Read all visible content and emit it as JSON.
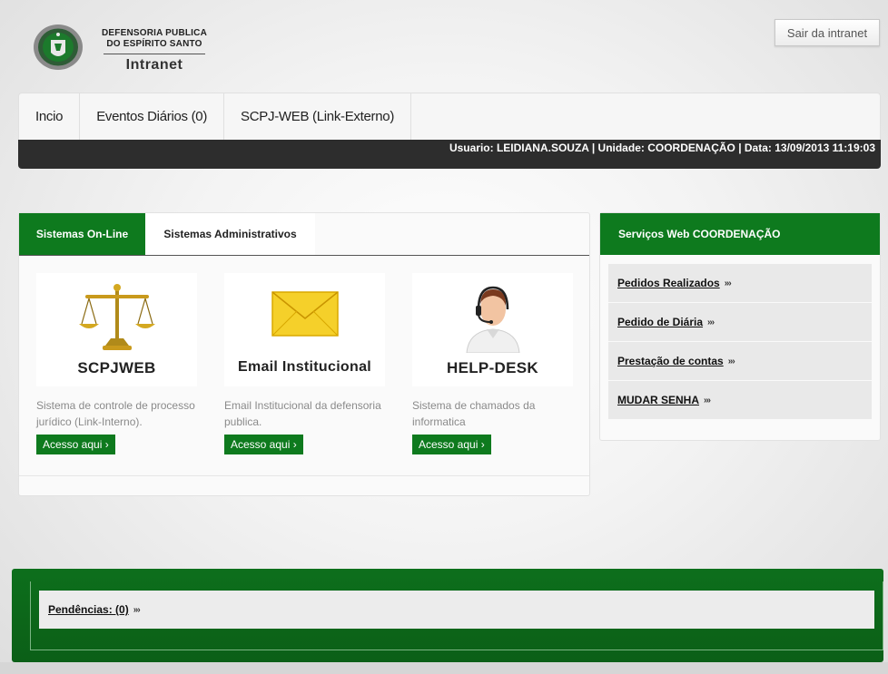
{
  "header": {
    "org_line1": "DEFENSORIA PUBLICA",
    "org_line2": "DO ESPÍRITO SANTO",
    "brand": "Intranet",
    "logout_label": "Sair da intranet"
  },
  "nav": {
    "items": [
      {
        "label": "Incio"
      },
      {
        "label": "Eventos Diários (0)"
      },
      {
        "label": "SCPJ-WEB (Link-Externo)"
      }
    ]
  },
  "status": {
    "text": "Usuario: LEIDIANA.SOUZA | Unidade: COORDENAÇÃO | Data: 13/09/2013 11:19:03"
  },
  "systems": {
    "tabs": [
      {
        "label": "Sistemas On-Line",
        "active": true
      },
      {
        "label": "Sistemas Administrativos",
        "active": false
      }
    ],
    "cards": [
      {
        "title": "SCPJWEB",
        "icon": "scales-icon",
        "description": "Sistema de controle de processo jurídico (Link-Interno).",
        "button": "Acesso aqui ›"
      },
      {
        "title": "Email Institucional",
        "icon": "envelope-icon",
        "description": "Email Institucional da defensoria publica.",
        "button": "Acesso aqui ›"
      },
      {
        "title": "HELP-DESK",
        "icon": "headset-agent-icon",
        "description": "Sistema de chamados da informatica",
        "button": "Acesso aqui ›"
      }
    ]
  },
  "services": {
    "title": "Serviços Web COORDENAÇÃO",
    "items": [
      {
        "label": "Pedidos Realizados"
      },
      {
        "label": "Pedido de Diária"
      },
      {
        "label": "Prestação de contas"
      },
      {
        "label": "MUDAR SENHA"
      }
    ],
    "chevron": "›››"
  },
  "footer": {
    "pending_label": "Pendências: (0)",
    "chevron": "›››"
  },
  "colors": {
    "green": "#0e7a1e",
    "dark_bar": "#2d2d2d"
  }
}
